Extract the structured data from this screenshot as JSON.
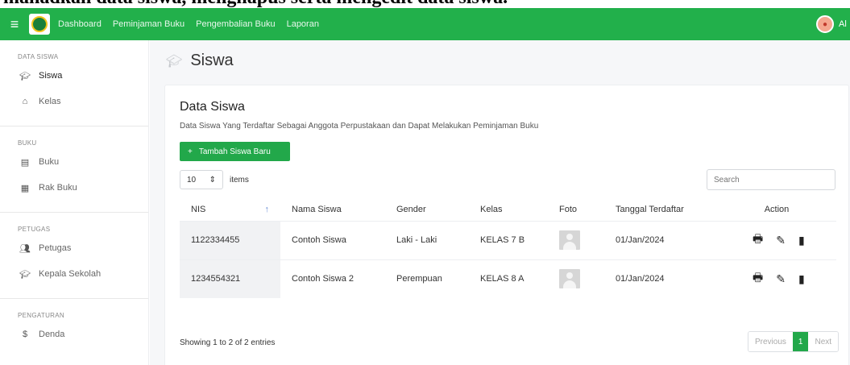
{
  "caption": "mahadkan data siswa, menghapus serta mengedit data siswa.",
  "topbar": {
    "menu_icon": "hamburger-icon",
    "logo_icon": "school-emblem-logo",
    "nav": [
      "Dashboard",
      "Peminjaman Buku",
      "Pengembalian Buku",
      "Laporan"
    ],
    "user_initial": "Al",
    "accent": "#22b04b"
  },
  "sidebar": {
    "sections": [
      {
        "title": "DATA SISWA",
        "items": [
          {
            "label": "Siswa",
            "icon": "graduation-cap-icon"
          },
          {
            "label": "Kelas",
            "icon": "home-icon"
          }
        ]
      },
      {
        "title": "BUKU",
        "items": [
          {
            "label": "Buku",
            "icon": "book-icon"
          },
          {
            "label": "Rak Buku",
            "icon": "shelf-icon"
          }
        ]
      },
      {
        "title": "PETUGAS",
        "items": [
          {
            "label": "Petugas",
            "icon": "users-icon"
          },
          {
            "label": "Kepala Sekolah",
            "icon": "graduation-cap-icon"
          }
        ]
      },
      {
        "title": "PENGATURAN",
        "items": [
          {
            "label": "Denda",
            "icon": "money-icon"
          }
        ]
      }
    ]
  },
  "page": {
    "title": "Siswa",
    "title_icon": "graduation-cap-icon"
  },
  "card": {
    "title": "Data Siswa",
    "subtitle": "Data Siswa Yang Terdaftar Sebagai Anggota Perpustakaan dan Dapat Melakukan Peminjaman Buku",
    "add_button": "Tambah Siswa Baru",
    "length_value": "10",
    "length_label": "items",
    "search_placeholder": "Search"
  },
  "table": {
    "headers": [
      "NIS",
      "Nama Siswa",
      "Gender",
      "Kelas",
      "Foto",
      "Tanggal Terdaftar",
      "Action"
    ],
    "sort_indicator": "↑",
    "rows": [
      {
        "nis": "1122334455",
        "nama": "Contoh Siswa",
        "gender": "Laki - Laki",
        "kelas": "KELAS 7 B",
        "tanggal": "01/Jan/2024"
      },
      {
        "nis": "1234554321",
        "nama": "Contoh Siswa 2",
        "gender": "Perempuan",
        "kelas": "KELAS 8 A",
        "tanggal": "01/Jan/2024"
      }
    ]
  },
  "footer": {
    "info": "Showing 1 to 2 of 2 entries",
    "prev": "Previous",
    "page": "1",
    "next": "Next"
  }
}
